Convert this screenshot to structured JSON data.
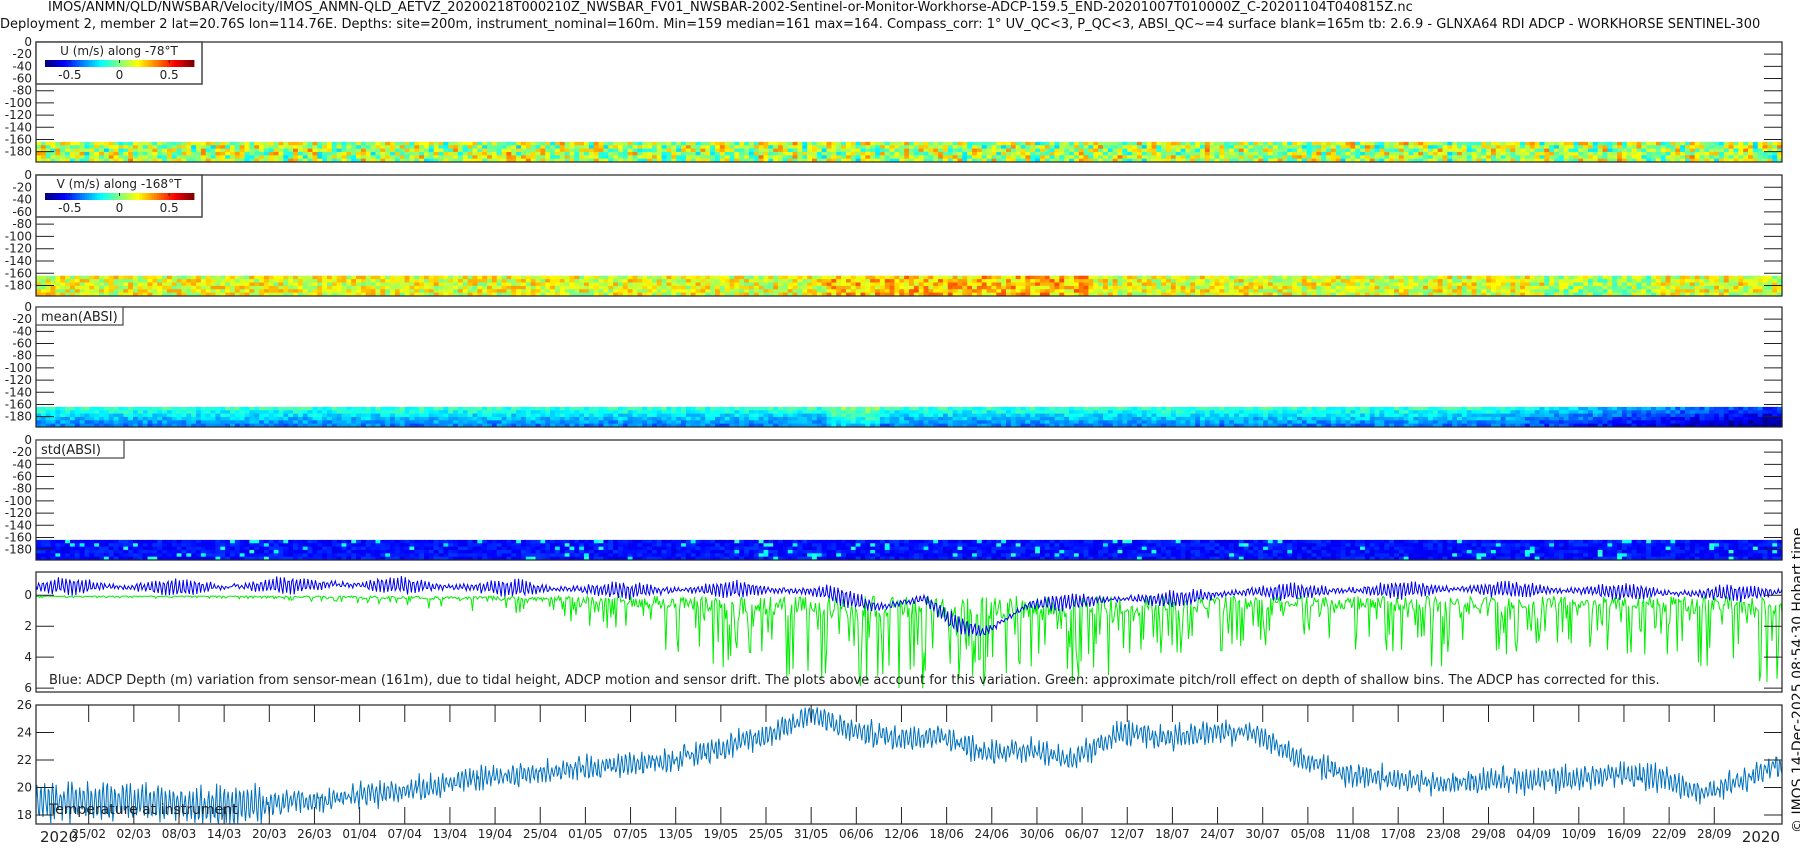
{
  "header": {
    "title_line1": "IMOS/ANMN/QLD/NWSBAR/Velocity/IMOS_ANMN-QLD_AETVZ_20200218T000210Z_NWSBAR_FV01_NWSBAR-2002-Sentinel-or-Monitor-Workhorse-ADCP-159.5_END-20201007T010000Z_C-20201104T040815Z.nc",
    "title_line2": "Deployment 2, member 2 lat=20.76S lon=114.76E. Depths: site=200m, instrument_nominal=160m. Min=159 median=161 max=164. Compass_corr: 1° UV_QC<3, P_QC<3, ABSI_QC~=4 surface blank=165m tb: 2.6.9 - GLNXA64 RDI ADCP - WORKHORSE SENTINEL-300"
  },
  "copyright": "© IMOS 14-Dec-2025 08:54:30 Hobart time",
  "colors": {
    "depth_blue": "#0000ee",
    "pitch_green": "#00ee00",
    "temp_blue": "#0072bd"
  },
  "chart_data": [
    {
      "type": "heatmap",
      "id": "u",
      "legend_title": "U (m/s) along -78°T",
      "colorbar_ticks": [
        "-0.5",
        "0",
        "0.5"
      ],
      "clim": [
        -0.75,
        0.75
      ],
      "ylabel_ticks": [
        "0",
        "-20",
        "-40",
        "-60",
        "-80",
        "-100",
        "-120",
        "-140",
        "-160",
        "-180"
      ],
      "ylim": [
        -197,
        0
      ],
      "data_depth_range": [
        -197,
        -164
      ],
      "typical_value": 0.05,
      "spread": 0.2
    },
    {
      "type": "heatmap",
      "id": "v",
      "legend_title": "V (m/s) along -168°T",
      "colorbar_ticks": [
        "-0.5",
        "0",
        "0.5"
      ],
      "clim": [
        -0.75,
        0.75
      ],
      "ylabel_ticks": [
        "0",
        "-20",
        "-40",
        "-60",
        "-80",
        "-100",
        "-120",
        "-140",
        "-160",
        "-180"
      ],
      "ylim": [
        -197,
        0
      ],
      "data_depth_range": [
        -197,
        -164
      ],
      "typical_value": 0.12,
      "spread": 0.18
    },
    {
      "type": "heatmap",
      "id": "mean",
      "legend_title": "mean(ABSI)",
      "ylabel_ticks": [
        "0",
        "-20",
        "-40",
        "-60",
        "-80",
        "-100",
        "-120",
        "-140",
        "-160",
        "-180"
      ],
      "ylim": [
        -197,
        0
      ],
      "data_depth_range": [
        -197,
        -164
      ]
    },
    {
      "type": "heatmap",
      "id": "std",
      "legend_title": "std(ABSI)",
      "ylabel_ticks": [
        "0",
        "-20",
        "-40",
        "-60",
        "-80",
        "-100",
        "-120",
        "-140",
        "-160",
        "-180"
      ],
      "ylim": [
        -197,
        0
      ],
      "data_depth_range": [
        -197,
        -164
      ]
    },
    {
      "type": "line",
      "id": "depth",
      "ylim": [
        -1.5,
        6.25
      ],
      "yreversed": true,
      "ylabel_ticks": [
        "0",
        "2",
        "4",
        "6"
      ],
      "annotation": "Blue: ADCP Depth (m) variation from sensor-mean (161m), due to tidal height, ADCP motion and sensor drift. The plots above account for this variation. Green: approximate pitch/roll effect on depth of shallow bins. The ADCP has corrected for this.",
      "series": [
        {
          "name": "ADCP depth variation",
          "color": "#0000ee",
          "knot_days": [
            0,
            20,
            40,
            60,
            80,
            95,
            105,
            112,
            118,
            122,
            126,
            132,
            138,
            145,
            150,
            160,
            175,
            190,
            205,
            220,
            232
          ],
          "knot_values": [
            -0.6,
            -0.5,
            -0.7,
            -0.5,
            -0.3,
            -0.4,
            -0.2,
            0.8,
            0.2,
            1.8,
            2.4,
            0.6,
            0.4,
            0.2,
            0.3,
            -0.2,
            -0.3,
            -0.4,
            -0.3,
            -0.1,
            -0.2
          ]
        },
        {
          "name": "pitch/roll effect",
          "color": "#00ee00",
          "knot_days": [
            0,
            30,
            50,
            70,
            80,
            90,
            100,
            110,
            120,
            130,
            140,
            150,
            170,
            190,
            200,
            215,
            232
          ],
          "knot_amplitude": [
            0.1,
            0.2,
            0.8,
            1.5,
            3,
            4.5,
            5.5,
            6,
            6,
            6,
            5.5,
            4,
            3,
            5,
            3,
            4,
            6
          ]
        }
      ]
    },
    {
      "type": "line",
      "id": "temp",
      "label": "Temperature at instrument",
      "ylim": [
        17.35,
        26
      ],
      "ylabel_ticks": [
        "18",
        "20",
        "22",
        "24",
        "26"
      ],
      "series": [
        {
          "name": "Temperature",
          "color": "#0072bd",
          "knot_days": [
            0,
            12,
            24,
            37,
            49,
            61,
            73,
            85,
            97,
            103,
            108,
            114,
            120,
            126,
            132,
            138,
            144,
            150,
            156,
            162,
            168,
            174,
            180,
            186,
            192,
            198,
            204,
            210,
            216,
            222,
            232
          ],
          "knot_values": [
            19,
            19,
            18.6,
            19,
            19.8,
            20.8,
            21.4,
            22,
            23.8,
            25.3,
            24.2,
            23.6,
            23.8,
            22.5,
            22.8,
            22,
            24,
            23.6,
            24,
            24,
            22,
            21,
            20.6,
            20.2,
            20.5,
            20.6,
            20.6,
            21,
            20.6,
            19.6,
            21.8
          ]
        }
      ]
    }
  ],
  "xaxis": {
    "start": "2020-02-18",
    "days": 232,
    "tick_labels": [
      "25/02",
      "02/03",
      "08/03",
      "14/03",
      "20/03",
      "26/03",
      "01/04",
      "07/04",
      "13/04",
      "19/04",
      "25/04",
      "01/05",
      "07/05",
      "13/05",
      "19/05",
      "25/05",
      "31/05",
      "06/06",
      "12/06",
      "18/06",
      "24/06",
      "30/06",
      "06/07",
      "12/07",
      "18/07",
      "24/07",
      "30/07",
      "05/08",
      "11/08",
      "17/08",
      "23/08",
      "29/08",
      "04/09",
      "10/09",
      "16/09",
      "22/09",
      "28/09"
    ],
    "first_tick_day": 7,
    "tick_step_days": 6,
    "year_left": "2020",
    "year_right": "2020"
  }
}
